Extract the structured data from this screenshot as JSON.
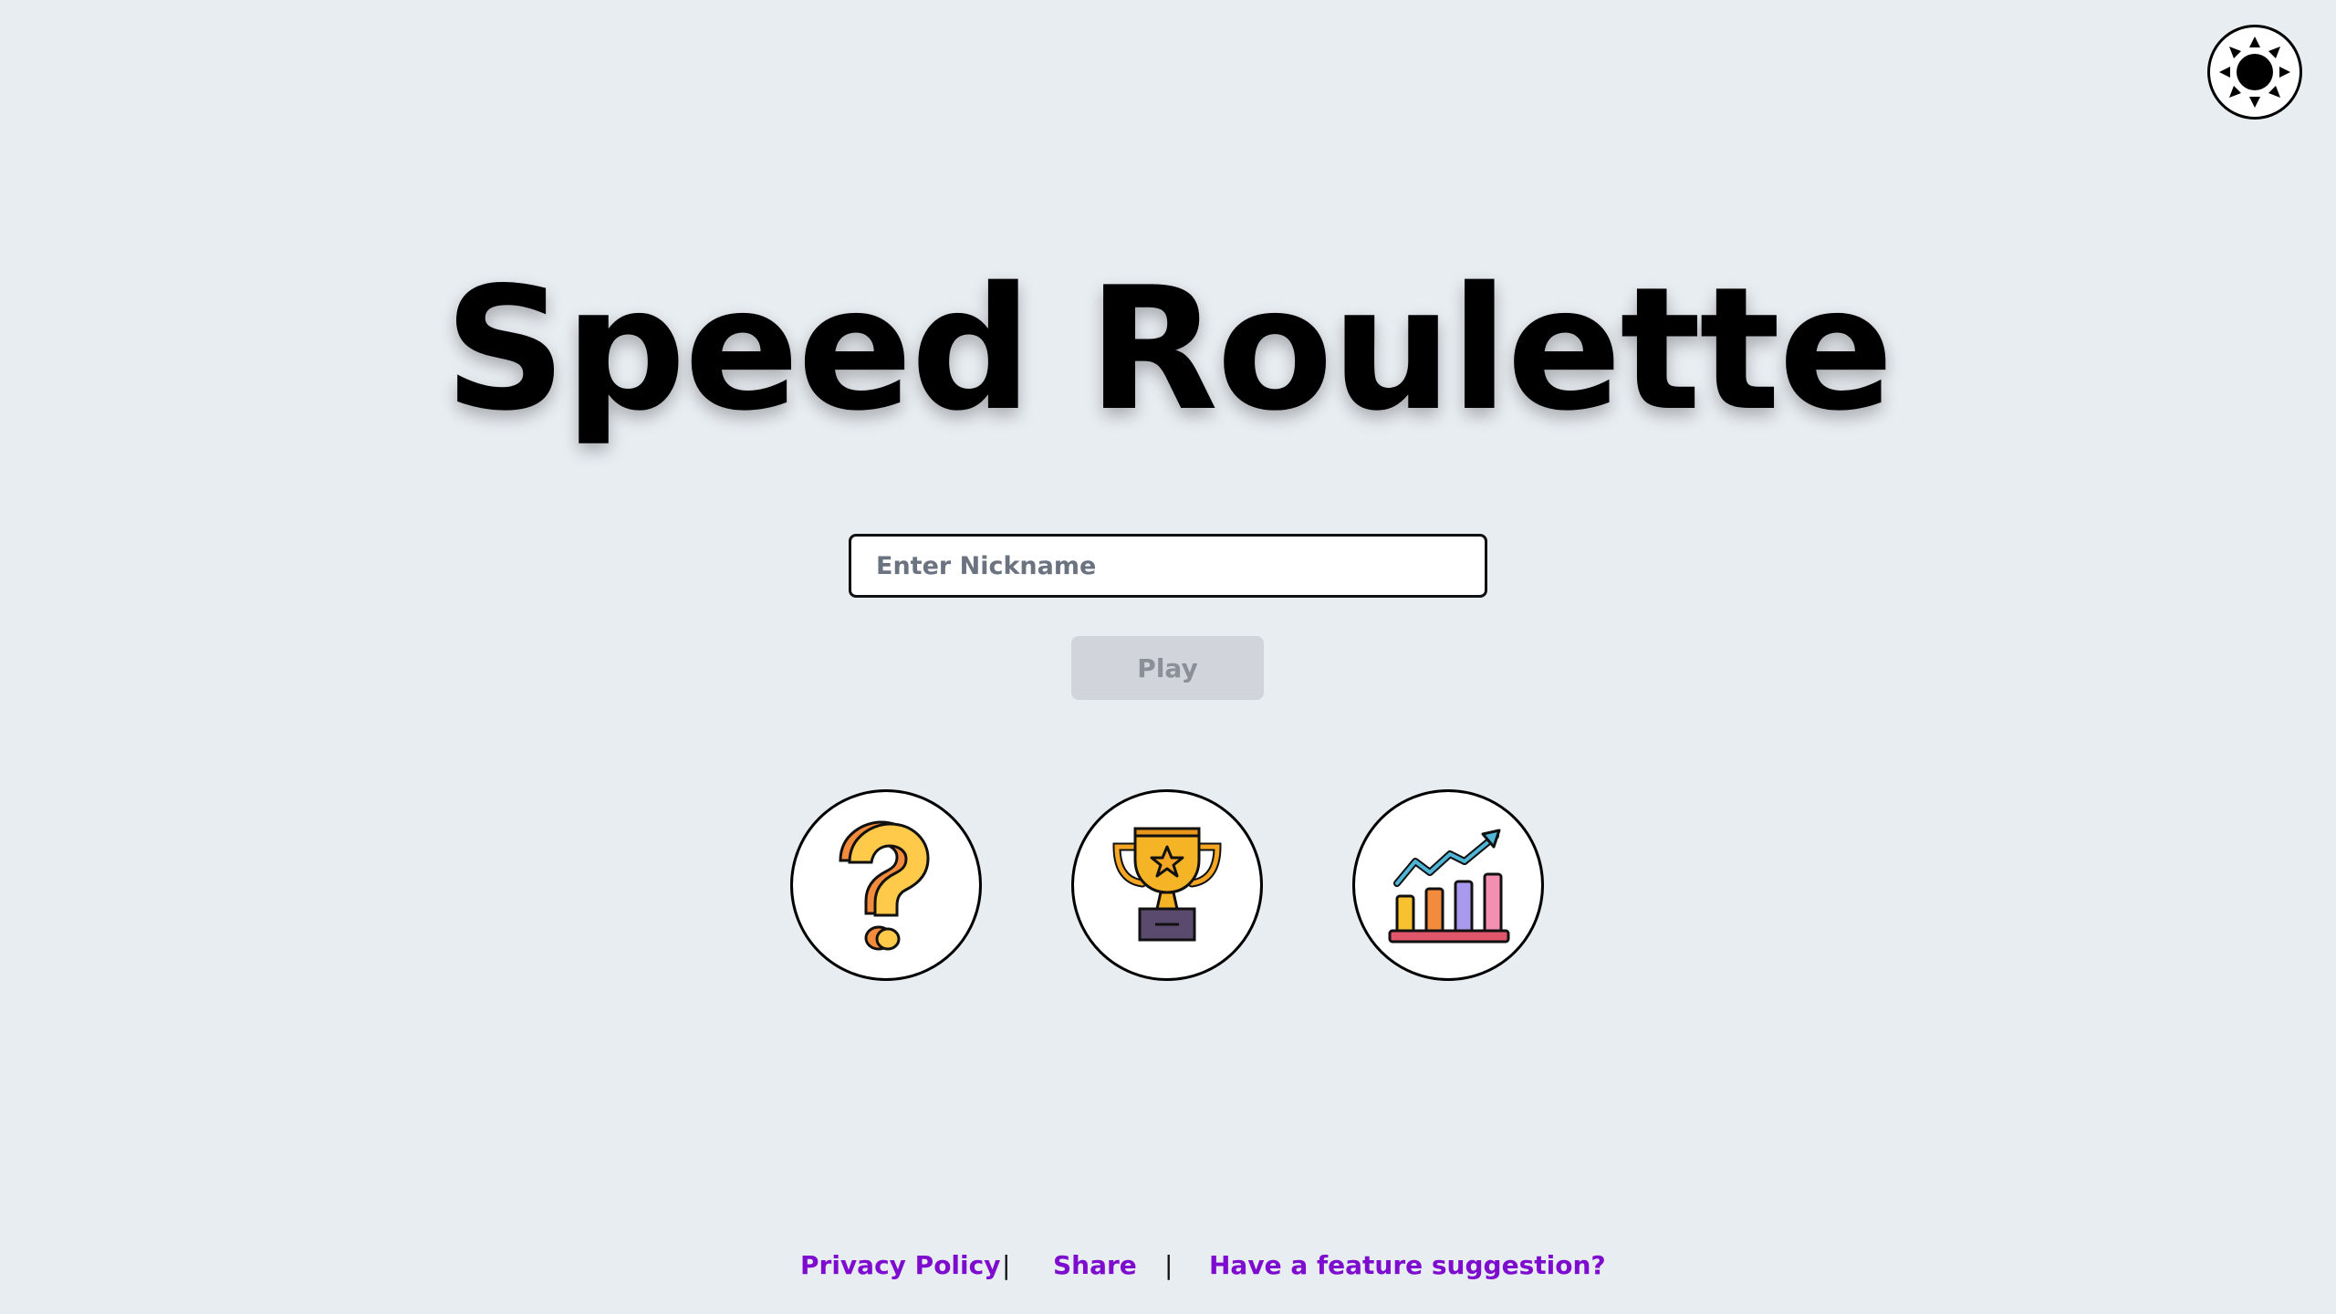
{
  "header": {
    "theme_toggle_icon": "sun-icon"
  },
  "main": {
    "title": "Speed Roulette",
    "nickname": {
      "placeholder": "Enter Nickname",
      "value": ""
    },
    "play_label": "Play",
    "play_enabled": false,
    "action_buttons": [
      {
        "name": "help",
        "icon": "question-mark-icon"
      },
      {
        "name": "leaderboard",
        "icon": "trophy-icon"
      },
      {
        "name": "statistics",
        "icon": "bar-chart-icon"
      }
    ]
  },
  "footer": {
    "links": [
      {
        "label": "Privacy Policy"
      },
      {
        "label": "Share"
      },
      {
        "label": "Have a feature suggestion?"
      }
    ],
    "separator": "|"
  },
  "colors": {
    "background": "#e8edf2",
    "link": "#7e0ccf",
    "play_disabled_bg": "#d1d5db",
    "play_disabled_text": "#8a8f98"
  }
}
